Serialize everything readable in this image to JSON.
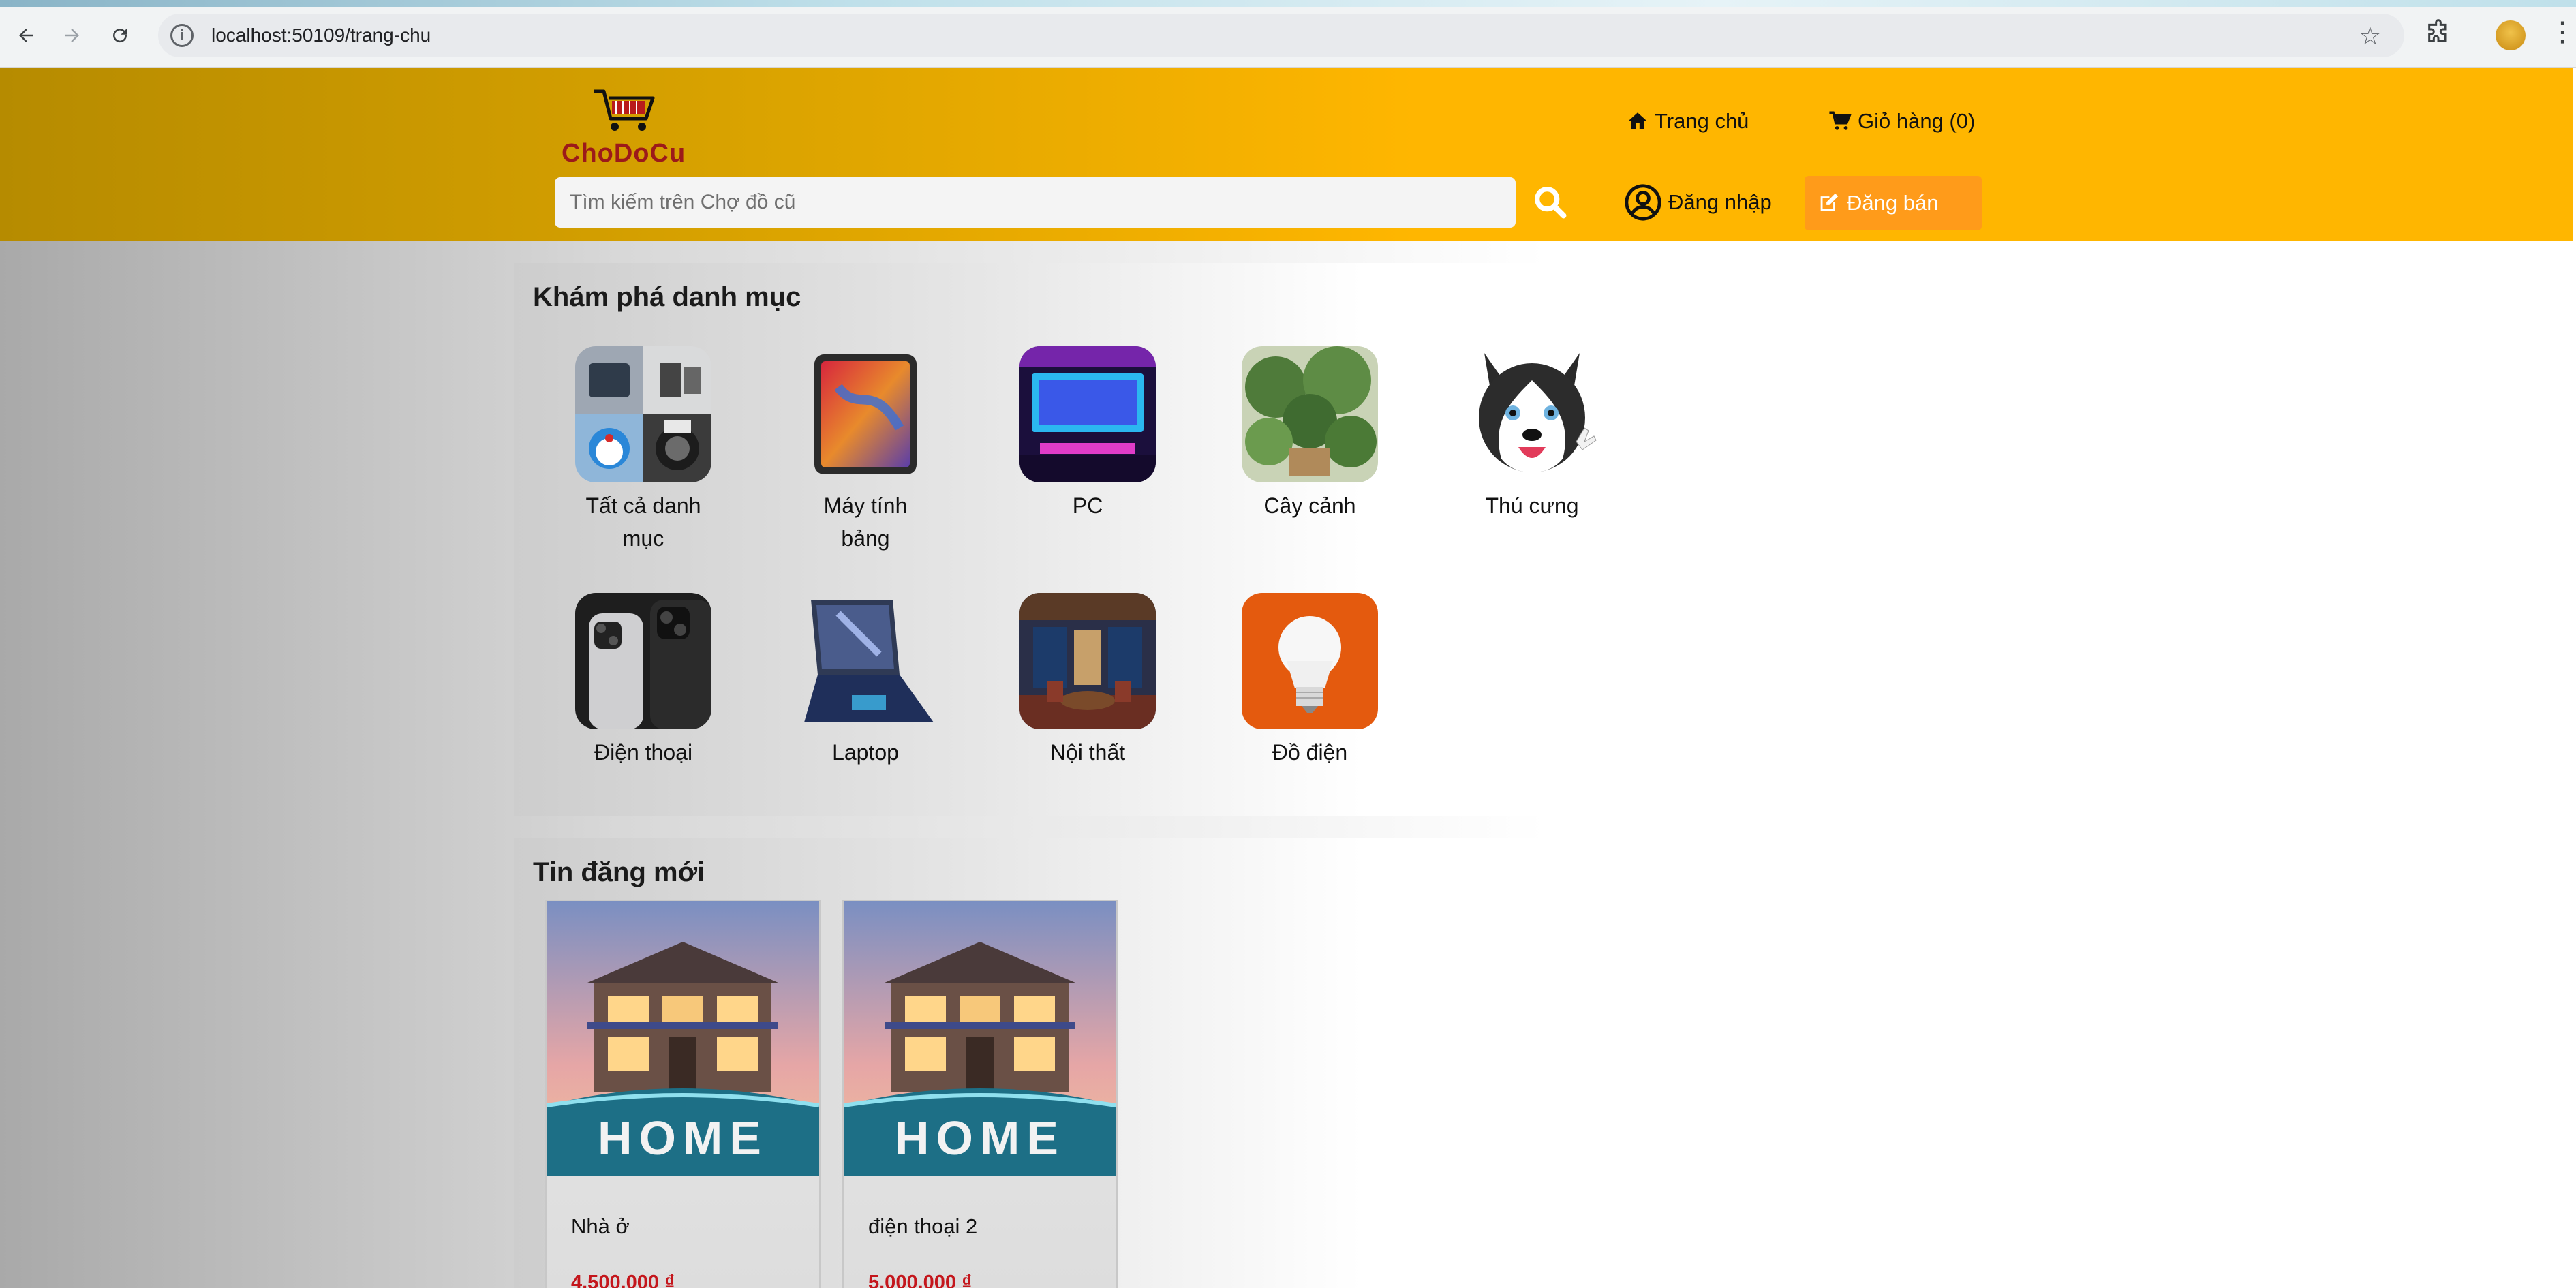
{
  "browser": {
    "url": "localhost:50109/trang-chu"
  },
  "header": {
    "logo_text": "ChoDoCu",
    "search_placeholder": "Tìm kiếm trên Chợ đồ cũ",
    "nav_home": "Trang chủ",
    "nav_cart": "Giỏ hàng (0)",
    "nav_login": "Đăng nhập",
    "btn_post": "Đăng bán"
  },
  "categories": {
    "title": "Khám phá danh mục",
    "items": [
      {
        "label": "Tất cả danh mục",
        "icon": "all-categories-image"
      },
      {
        "label": "Máy tính bảng",
        "icon": "tablet-image"
      },
      {
        "label": "PC",
        "icon": "pc-image"
      },
      {
        "label": "Cây cảnh",
        "icon": "plant-image"
      },
      {
        "label": "Thú cưng",
        "icon": "pet-image"
      },
      {
        "label": "Điện thoại",
        "icon": "phone-image"
      },
      {
        "label": "Laptop",
        "icon": "laptop-image"
      },
      {
        "label": "Nội thất",
        "icon": "furniture-image"
      },
      {
        "label": "Đồ điện",
        "icon": "lightbulb-image"
      }
    ]
  },
  "new_posts": {
    "title": "Tin đăng mới",
    "items": [
      {
        "name": "Nhà ở",
        "price": "4.500.000 ₫",
        "image_text": "HOME"
      },
      {
        "name": "điện thoại 2",
        "price": "5.000.000 ₫",
        "image_text": "HOME"
      }
    ]
  },
  "colors": {
    "header_yellow": "#ffb600",
    "post_button": "#ff9b1a",
    "price_red": "#c4161c",
    "logo_red": "#9c1a1a"
  }
}
